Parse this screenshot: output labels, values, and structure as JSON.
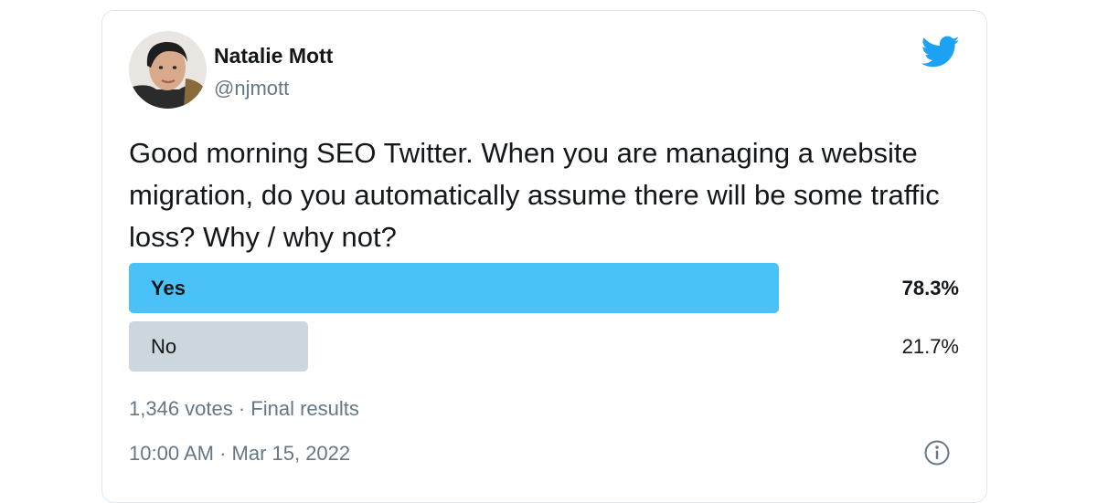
{
  "author": {
    "display_name": "Natalie Mott",
    "handle": "@njmott"
  },
  "tweet": {
    "text": "Good morning SEO Twitter. When you are managing a website migration, do you automatically assume there will be some traffic loss? Why / why not?"
  },
  "poll": {
    "options": [
      {
        "label": "Yes",
        "percent_text": "78.3%",
        "percent": 78.3,
        "winner": true
      },
      {
        "label": "No",
        "percent_text": "21.7%",
        "percent": 21.7,
        "winner": false
      }
    ],
    "summary": "1,346 votes · Final results"
  },
  "timestamp": "10:00 AM · Mar 15, 2022",
  "icons": {
    "brand": "twitter-bird-icon",
    "info": "info-icon"
  },
  "colors": {
    "twitter_blue": "#1da1f2",
    "winning_bar": "#4ac2f7",
    "losing_bar": "#ccd6dd",
    "secondary_text": "#657786"
  }
}
